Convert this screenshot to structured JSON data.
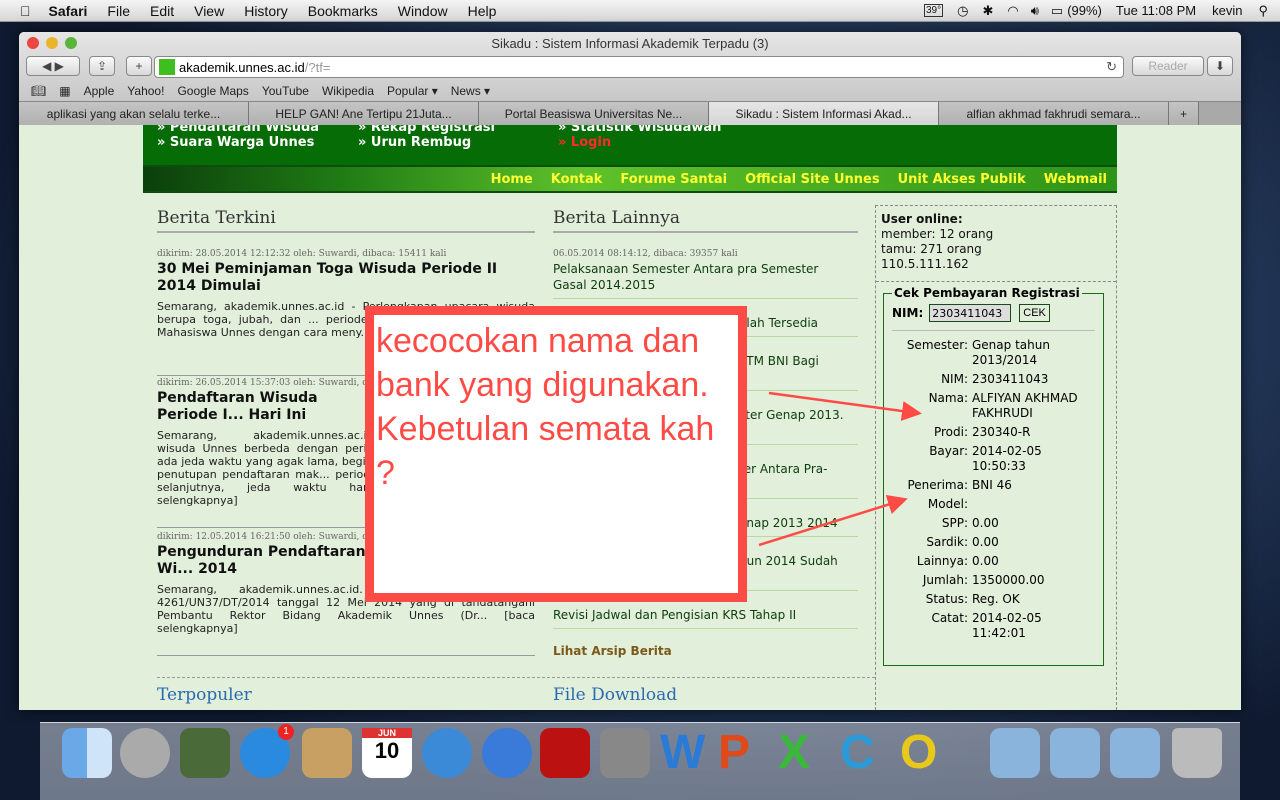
{
  "menubar": {
    "app": "Safari",
    "items": [
      "File",
      "Edit",
      "View",
      "History",
      "Bookmarks",
      "Window",
      "Help"
    ],
    "temp": "39°",
    "battery": "(99%)",
    "clock": "Tue 11:08 PM",
    "user": "kevin"
  },
  "window": {
    "title": "Sikadu : Sistem Informasi Akademik Terpadu (3)"
  },
  "toolbar": {
    "url_host": "akademik.unnes.ac.id",
    "url_path": "/?tf=",
    "reader": "Reader"
  },
  "bookmarks": [
    "Apple",
    "Yahoo!",
    "Google Maps",
    "YouTube",
    "Wikipedia",
    "Popular ▾",
    "News ▾"
  ],
  "tabs": [
    "aplikasi yang akan selalu terke...",
    "HELP GAN! Ane Tertipu 21Juta...",
    "Portal Beasiswa Universitas Ne...",
    "Sikadu : Sistem Informasi Akad...",
    "alfian akhmad fakhrudi semara..."
  ],
  "header_links": {
    "c1": [
      "» Pendaftaran Wisuda",
      "» Suara Warga Unnes"
    ],
    "c2": [
      "» Rekap Registrasi",
      "» Urun Rembug"
    ],
    "c3": [
      "» Statistik Wisudawan",
      "» Login"
    ]
  },
  "nav": [
    "Home",
    "Kontak",
    "Forume Santai",
    "Official Site Unnes",
    "Unit Akses Publik",
    "Webmail"
  ],
  "berita_terkini": {
    "heading": "Berita Terkini",
    "articles": [
      {
        "meta": "dikirim: 28.05.2014 12:12:32 oleh: Suwardi, dibaca: 15411 kali",
        "title": "30 Mei Peminjaman Toga Wisuda Periode II 2014 Dimulai",
        "body": "Semarang, akademik.unnes.ac.id - Perlengkapan upacara wisuda berupa toga, jubah, dan ... periode II tahun 2014 Unnes aka... Mahasiswa Unnes dengan cara meny..."
      },
      {
        "meta": "dikirim: 26.05.2014 15:37:03 oleh: Suwardi, dib",
        "title": "Pendaftaran Wisuda Periode I... Hari Ini",
        "body": "Semarang, akademik.unnes.ac.id. wisuda Unnes berbeda dengan peri... ada jeda waktu yang agak lama, begitu penutupan pendaftaran mak... periode selanjutnya, jeda waktu har... selengkapnya]"
      },
      {
        "meta": "dikirim: 12.05.2014 16:21:50 oleh: Suwardi, dib",
        "title": "Pengunduran Pendaftaran Wi... 2014",
        "body": "Semarang, akademik.unnes.ac.id. Rektor Unnes nomor 4261/UN37/DT/2014 tanggal 12 Mei 2014 yang di tandatangani Pembantu Rektor Bidang Akademik Unnes (Dr... [baca selengkapnya]"
      }
    ]
  },
  "berita_lainnya": {
    "heading": "Berita Lainnya",
    "first_meta": "06.05.2014 08:14:12, dibaca: 39357 kali",
    "items": [
      "Pelaksanaan Semester Antara pra Semester Gasal 2014.2015",
      "elah Tersedia",
      "ATM BNI Bagi",
      "ster Genap 2013.",
      "ter Antara Pra-",
      "enap 2013 2014",
      "hun 2014 Sudah",
      "Revisi Jadwal dan Pengisian KRS Tahap II"
    ],
    "archive": "Lihat Arsip Berita"
  },
  "bottom": {
    "terpopuler": "Terpopuler",
    "download": "File Download"
  },
  "user_online": {
    "title": "User online:",
    "member": "member: 12 orang",
    "tamu": "tamu: 271 orang",
    "ip": "110.5.111.162"
  },
  "cek": {
    "legend": "Cek Pembayaran Registrasi",
    "nim_label": "NIM:",
    "nim_value": "2303411043",
    "button": "CEK",
    "rows": [
      [
        "Semester:",
        "Genap tahun 2013/2014"
      ],
      [
        "NIM:",
        "2303411043"
      ],
      [
        "Nama:",
        "ALFIYAN AKHMAD FAKHRUDI"
      ],
      [
        "Prodi:",
        "230340-R"
      ],
      [
        "Bayar:",
        "2014-02-05 10:50:33"
      ],
      [
        "Penerima:",
        "BNI 46"
      ],
      [
        "Model:",
        ""
      ],
      [
        "SPP:",
        "0.00"
      ],
      [
        "Sardik:",
        "0.00"
      ],
      [
        "Lainnya:",
        "0.00"
      ],
      [
        "Jumlah:",
        "1350000.00"
      ],
      [
        "Status:",
        "Reg. OK"
      ],
      [
        "Catat:",
        "2014-02-05 11:42:01"
      ]
    ]
  },
  "annotation": {
    "text": "kecocokan nama dan bank yang digunakan. Kebetulan semata kah ?",
    "color": "#ff4b45"
  },
  "dock": {
    "calendar_month": "JUN",
    "calendar_day": "10",
    "appstore_badge": "1"
  }
}
